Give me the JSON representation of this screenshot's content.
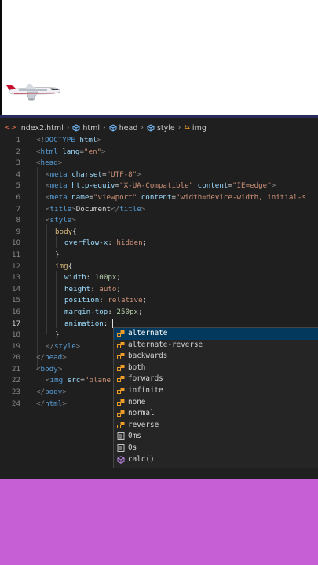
{
  "breadcrumb": [
    {
      "label": "index2.html",
      "icon": "html-file-icon"
    },
    {
      "label": "html",
      "icon": "element-icon"
    },
    {
      "label": "head",
      "icon": "element-icon"
    },
    {
      "label": "style",
      "icon": "element-icon"
    },
    {
      "label": "img",
      "icon": "css-rule-icon"
    }
  ],
  "line_numbers": [
    "1",
    "2",
    "3",
    "4",
    "5",
    "6",
    "7",
    "8",
    "9",
    "10",
    "11",
    "12",
    "13",
    "14",
    "15",
    "16",
    "17",
    "18",
    "19",
    "20",
    "21",
    "22",
    "23",
    "24"
  ],
  "current_line": "17",
  "code_lines": [
    [
      [
        "<!",
        "p"
      ],
      [
        "DOCTYPE",
        "t"
      ],
      [
        " html",
        "a"
      ],
      [
        ">",
        "p"
      ]
    ],
    [
      [
        "<",
        "p"
      ],
      [
        "html",
        "t"
      ],
      [
        " lang",
        "a"
      ],
      [
        "=",
        "x"
      ],
      [
        "\"en\"",
        "s"
      ],
      [
        ">",
        "p"
      ]
    ],
    [
      [
        "<",
        "p"
      ],
      [
        "head",
        "t"
      ],
      [
        ">",
        "p"
      ]
    ],
    [
      [
        "<",
        "p"
      ],
      [
        "meta",
        "t"
      ],
      [
        " charset",
        "a"
      ],
      [
        "=",
        "x"
      ],
      [
        "\"UTF-8\"",
        "s"
      ],
      [
        ">",
        "p"
      ]
    ],
    [
      [
        "<",
        "p"
      ],
      [
        "meta",
        "t"
      ],
      [
        " http-equiv",
        "a"
      ],
      [
        "=",
        "x"
      ],
      [
        "\"X-UA-Compatible\"",
        "s"
      ],
      [
        " content",
        "a"
      ],
      [
        "=",
        "x"
      ],
      [
        "\"IE=edge\"",
        "s"
      ],
      [
        ">",
        "p"
      ]
    ],
    [
      [
        "<",
        "p"
      ],
      [
        "meta",
        "t"
      ],
      [
        " name",
        "a"
      ],
      [
        "=",
        "x"
      ],
      [
        "\"viewport\"",
        "s"
      ],
      [
        " content",
        "a"
      ],
      [
        "=",
        "x"
      ],
      [
        "\"width=device-width, initial-s",
        "s"
      ]
    ],
    [
      [
        "<",
        "p"
      ],
      [
        "title",
        "t"
      ],
      [
        ">",
        "p"
      ],
      [
        "Document",
        "x"
      ],
      [
        "</",
        "p"
      ],
      [
        "title",
        "t"
      ],
      [
        ">",
        "p"
      ]
    ],
    [
      [
        "<",
        "p"
      ],
      [
        "style",
        "t"
      ],
      [
        ">",
        "p"
      ]
    ],
    [
      [
        "body",
        "e"
      ],
      [
        "{",
        "x"
      ]
    ],
    [
      [
        "overflow-x",
        "r"
      ],
      [
        ": ",
        "x"
      ],
      [
        "hidden",
        "v"
      ],
      [
        ";",
        "x"
      ]
    ],
    [
      [
        "}",
        "x"
      ]
    ],
    [
      [
        "img",
        "e"
      ],
      [
        "{",
        "x"
      ]
    ],
    [
      [
        "width",
        "r"
      ],
      [
        ": ",
        "x"
      ],
      [
        "100px",
        "n"
      ],
      [
        ";",
        "x"
      ]
    ],
    [
      [
        "height",
        "r"
      ],
      [
        ": ",
        "x"
      ],
      [
        "auto",
        "v"
      ],
      [
        ";",
        "x"
      ]
    ],
    [
      [
        "position",
        "r"
      ],
      [
        ": ",
        "x"
      ],
      [
        "relative",
        "v"
      ],
      [
        ";",
        "x"
      ]
    ],
    [
      [
        "margin-top",
        "r"
      ],
      [
        ": ",
        "x"
      ],
      [
        "250px",
        "n"
      ],
      [
        ";",
        "x"
      ]
    ],
    [
      [
        "animation",
        "r"
      ],
      [
        ": ",
        "x"
      ]
    ],
    [
      [
        "}",
        "x"
      ]
    ],
    [
      [
        "</",
        "p"
      ],
      [
        "style",
        "t"
      ],
      [
        ">",
        "p"
      ]
    ],
    [
      [
        "</",
        "p"
      ],
      [
        "head",
        "t"
      ],
      [
        ">",
        "p"
      ]
    ],
    [
      [
        "<",
        "p"
      ],
      [
        "body",
        "t"
      ],
      [
        ">",
        "p"
      ]
    ],
    [
      [
        "<",
        "p"
      ],
      [
        "img",
        "t"
      ],
      [
        " src",
        "a"
      ],
      [
        "=",
        "x"
      ],
      [
        "\"plane",
        "s"
      ]
    ],
    [
      [
        "</",
        "p"
      ],
      [
        "body",
        "t"
      ],
      [
        ">",
        "p"
      ]
    ],
    [
      [
        "</",
        "p"
      ],
      [
        "html",
        "t"
      ],
      [
        ">",
        "p"
      ]
    ]
  ],
  "suggestions": [
    {
      "label": "alternate",
      "kind": "value"
    },
    {
      "label": "alternate-reverse",
      "kind": "value"
    },
    {
      "label": "backwards",
      "kind": "value"
    },
    {
      "label": "both",
      "kind": "value"
    },
    {
      "label": "forwards",
      "kind": "value"
    },
    {
      "label": "infinite",
      "kind": "value"
    },
    {
      "label": "none",
      "kind": "value"
    },
    {
      "label": "normal",
      "kind": "value"
    },
    {
      "label": "reverse",
      "kind": "value"
    },
    {
      "label": "0ms",
      "kind": "unit"
    },
    {
      "label": "0s",
      "kind": "unit"
    },
    {
      "label": "calc()",
      "kind": "function"
    }
  ],
  "selected_suggestion": "alternate",
  "colors": {
    "editor_bg": "#1f1f1f",
    "bottom_bg": "#c65ed6",
    "tag": "#569cd6",
    "attr": "#9cdcfe",
    "string": "#ce9178",
    "selector": "#d7ba7d",
    "number": "#b5cea8",
    "selection": "#04395e",
    "value_icon": "#ee9d28",
    "function_icon": "#b180d7"
  }
}
